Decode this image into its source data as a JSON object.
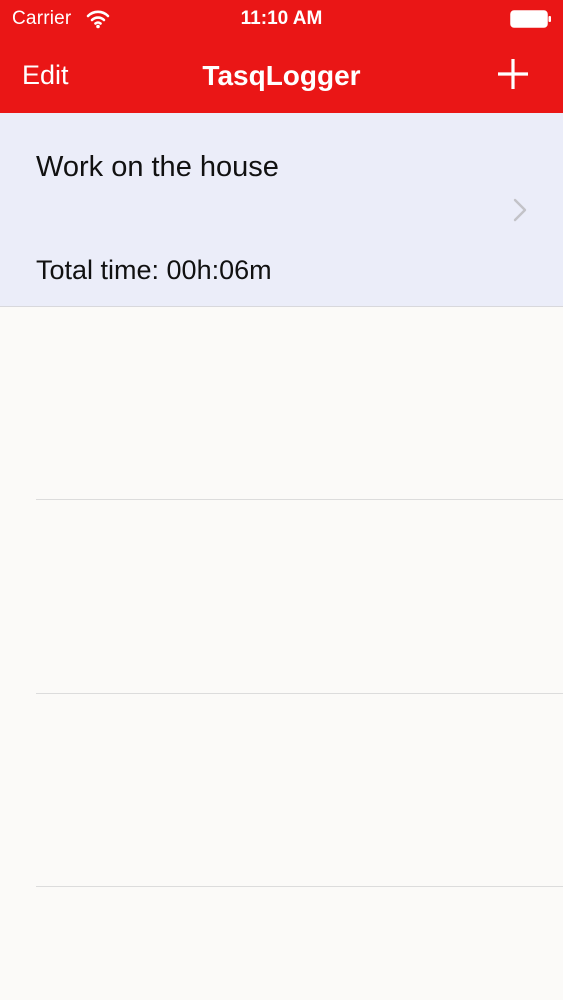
{
  "status_bar": {
    "carrier": "Carrier",
    "time": "11:10 AM",
    "icons": [
      "wifi-icon",
      "battery-icon"
    ]
  },
  "nav": {
    "edit_label": "Edit",
    "title": "TasqLogger",
    "add_icon": "plus-icon"
  },
  "tasks": [
    {
      "name": "Work on the house",
      "total_time": "Total time: 00h:06m",
      "accessory_icon": "chevron-right-icon"
    }
  ],
  "colors": {
    "header": "#ea1616",
    "selected_row": "#ebedf9",
    "background": "#fbfaf8"
  }
}
